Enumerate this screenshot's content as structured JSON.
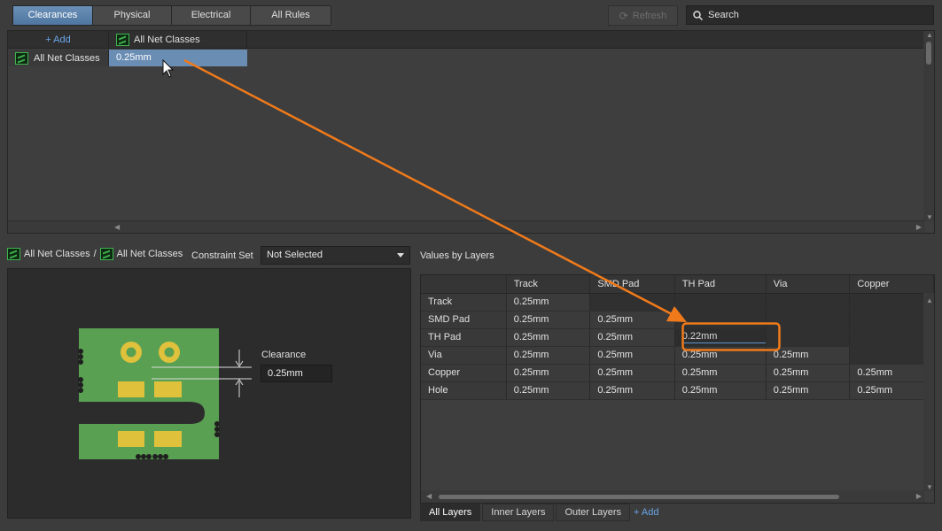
{
  "tabs": [
    {
      "label": "Clearances",
      "active": true
    },
    {
      "label": "Physical",
      "active": false
    },
    {
      "label": "Electrical",
      "active": false
    },
    {
      "label": "All Rules",
      "active": false
    }
  ],
  "toolbar": {
    "refresh_label": "Refresh",
    "search_label": "Search"
  },
  "matrix": {
    "add_label": "+ Add",
    "column_header": "All Net Classes",
    "row_label": "All Net Classes",
    "cell_value": "0.25mm"
  },
  "breadcrumb": {
    "from": "All Net Classes",
    "separator": "/",
    "to": "All Net Classes"
  },
  "constraint_set": {
    "label": "Constraint Set",
    "value": "Not Selected"
  },
  "values_title": "Values by Layers",
  "clearance": {
    "label": "Clearance",
    "value": "0.25mm"
  },
  "grid": {
    "columns": [
      "Track",
      "SMD Pad",
      "TH Pad",
      "Via",
      "Copper"
    ],
    "rows": [
      {
        "label": "Track",
        "cells": [
          "0.25mm",
          "",
          "",
          "",
          ""
        ]
      },
      {
        "label": "SMD Pad",
        "cells": [
          "0.25mm",
          "0.25mm",
          "",
          "",
          ""
        ]
      },
      {
        "label": "TH Pad",
        "cells": [
          "0.25mm",
          "0.25mm",
          "0.22mm",
          "",
          ""
        ]
      },
      {
        "label": "Via",
        "cells": [
          "0.25mm",
          "0.25mm",
          "0.25mm",
          "0.25mm",
          ""
        ]
      },
      {
        "label": "Copper",
        "cells": [
          "0.25mm",
          "0.25mm",
          "0.25mm",
          "0.25mm",
          "0.25mm"
        ]
      },
      {
        "label": "Hole",
        "cells": [
          "0.25mm",
          "0.25mm",
          "0.25mm",
          "0.25mm",
          "0.25mm"
        ]
      }
    ]
  },
  "layer_tabs": [
    {
      "label": "All Layers",
      "active": true
    },
    {
      "label": "Inner Layers",
      "active": false
    },
    {
      "label": "Outer Layers",
      "active": false
    }
  ],
  "layer_add_label": "+ Add",
  "colors": {
    "accent": "#5b82ad",
    "highlight": "#f07a1a",
    "pcb_green": "#5aa052",
    "pad_gold": "#e0c13c"
  }
}
